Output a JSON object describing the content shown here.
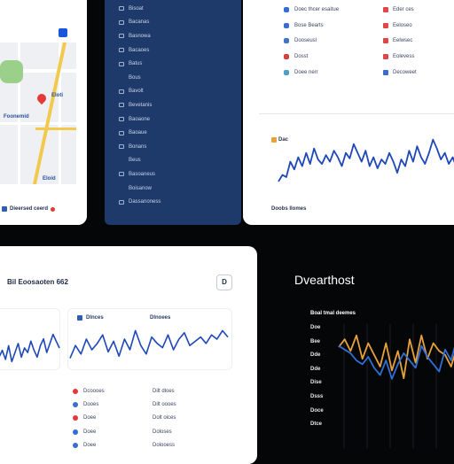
{
  "map_panel": {
    "labels": [
      "Eloti",
      "Foonemid",
      "Eloid"
    ],
    "footer_label": "Dieersed ceerd"
  },
  "sidebar": {
    "items": [
      {
        "label": "Bisoat",
        "has_icon": true
      },
      {
        "label": "Bacanas",
        "has_icon": true
      },
      {
        "label": "Basnowa",
        "has_icon": true
      },
      {
        "label": "Bacaoes",
        "has_icon": true
      },
      {
        "label": "Batus",
        "has_icon": true
      },
      {
        "label": "Bous",
        "has_icon": false
      },
      {
        "label": "Bavolt",
        "has_icon": true
      },
      {
        "label": "Bevetanis",
        "has_icon": true
      },
      {
        "label": "Baoaone",
        "has_icon": true
      },
      {
        "label": "Baoaue",
        "has_icon": true
      },
      {
        "label": "Bonans",
        "has_icon": true
      },
      {
        "label": "Beus",
        "has_icon": false
      },
      {
        "label": "Basoaneus",
        "has_icon": true
      },
      {
        "label": "Boisanow",
        "has_icon": false
      },
      {
        "label": "Dassanoness",
        "has_icon": true
      }
    ]
  },
  "top_right": {
    "rows": [
      {
        "label": "Doec thcer esaitue",
        "value": "Eder ces",
        "icon_color": "#2f6fd6",
        "icon2_color": "#e04848"
      },
      {
        "label": "Bose Bearts",
        "value": "Eeloseo",
        "icon_color": "#3a6dcc",
        "icon2_color": "#e04848"
      },
      {
        "label": "Dooseusl",
        "value": "Eelwsec",
        "icon_color": "#3f74c9",
        "icon2_color": "#e04848"
      },
      {
        "label": "Dosst",
        "value": "Eolevess",
        "icon_color": "#d94040",
        "icon2_color": "#e04848"
      },
      {
        "label": "Doee nerr",
        "value": "Decoweet",
        "icon_color": "#4fa0c8",
        "icon2_color": "#3a6dcc"
      }
    ],
    "chart_caption": "Dac",
    "footer_label": "Doobs Ilomes"
  },
  "bottom_left": {
    "title": "Bil Eoosaoten 662",
    "button_label": "D",
    "card_a_title": "",
    "card_b_title": "Dlnces",
    "card_c_title": "Dlnoees",
    "table_rows": [
      {
        "name": "Dcoooes",
        "value": "Dilt dloes",
        "dot_color": "#e53935"
      },
      {
        "name": "Dooes",
        "value": "Dilt oooes",
        "dot_color": "#3a6dcc"
      },
      {
        "name": "Doee",
        "value": "Dolt oices",
        "dot_color": "#e53935"
      },
      {
        "name": "Doee",
        "value": "Doloses",
        "dot_color": "#2f6fd6"
      },
      {
        "name": "Doee",
        "value": "Dolooess",
        "dot_color": "#3a6dcc"
      }
    ]
  },
  "dark_panel": {
    "title": "Dvearthost",
    "subtitle": "Boal tmal deemes",
    "axis_labels": [
      "Doe",
      "Bee",
      "Dde",
      "Dde",
      "Dise",
      "Dsss",
      "Doce",
      "Dtce"
    ],
    "colors": {
      "series_a": "#e8a23a",
      "series_b": "#2f6fd6"
    }
  },
  "chart_data": [
    {
      "type": "line",
      "series": [
        {
          "values": [
            44,
            50,
            48,
            62,
            55,
            66,
            58,
            70,
            60,
            74,
            64,
            60,
            68,
            62,
            72,
            66,
            58,
            70,
            65,
            78,
            70,
            62,
            72,
            58,
            66,
            56,
            64,
            60,
            70,
            62,
            52,
            64,
            58,
            72,
            62,
            76,
            66,
            60,
            70,
            82,
            74,
            64,
            70,
            60,
            66,
            56,
            62,
            58
          ]
        }
      ],
      "color": "#1e47b8"
    },
    {
      "type": "line",
      "series": [
        {
          "values": [
            40,
            46,
            38,
            50,
            36,
            44,
            52,
            40,
            48,
            44,
            54,
            46,
            40,
            50,
            56,
            44,
            52,
            60,
            54,
            48
          ]
        }
      ],
      "color": "#1e47b8"
    },
    {
      "type": "line",
      "series": [
        {
          "values": [
            40,
            52,
            44,
            58,
            48,
            54,
            62,
            46,
            56,
            42,
            58,
            48,
            66,
            52,
            44,
            60,
            54,
            50,
            62,
            48,
            58,
            64,
            52,
            56,
            60,
            54,
            62,
            58,
            66,
            60
          ]
        }
      ],
      "color": "#1e47b8"
    },
    {
      "type": "line",
      "series": [
        {
          "values": [
            56,
            60,
            54,
            62,
            50,
            58,
            52,
            46,
            58,
            44,
            54,
            40,
            60,
            48,
            62,
            50,
            58,
            54,
            52,
            46,
            56,
            50
          ]
        },
        {
          "values": [
            40,
            38,
            36,
            32,
            30,
            34,
            28,
            24,
            32,
            22,
            30,
            36,
            32,
            28,
            40,
            34,
            30,
            26,
            38,
            32,
            44,
            40
          ]
        }
      ]
    }
  ]
}
